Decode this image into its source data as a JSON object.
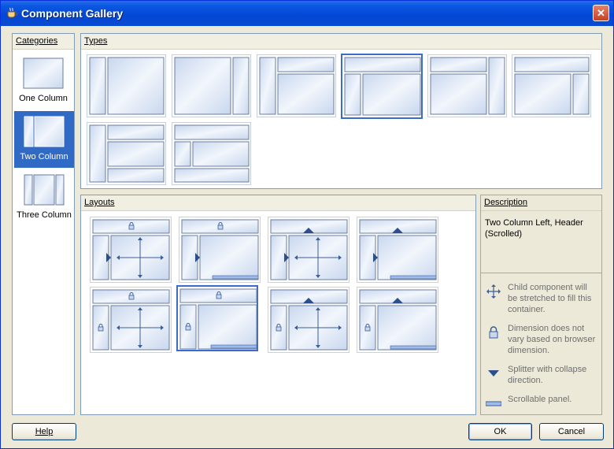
{
  "window": {
    "title": "Component Gallery",
    "close_glyph": "✕"
  },
  "categories": {
    "header": "Categories",
    "items": [
      {
        "label": "One Column"
      },
      {
        "label": "Two Column"
      },
      {
        "label": "Three Column"
      }
    ]
  },
  "types": {
    "header": "Types"
  },
  "layouts": {
    "header": "Layouts"
  },
  "description": {
    "header": "Description",
    "text": "Two Column Left, Header (Scrolled)",
    "legend": [
      {
        "icon": "stretch-arrows-icon",
        "text": "Child component will be stretched to fill this container."
      },
      {
        "icon": "lock-icon",
        "text": "Dimension does not vary based on browser dimension."
      },
      {
        "icon": "splitter-triangle-icon",
        "text": "Splitter with collapse direction."
      },
      {
        "icon": "scroll-bar-icon",
        "text": "Scrollable panel."
      }
    ]
  },
  "buttons": {
    "help": "Help",
    "ok": "OK",
    "cancel": "Cancel"
  },
  "colors": {
    "accent": "#316ac5",
    "title": "#0a58e2",
    "panel_fill": "#dfe8f5"
  }
}
